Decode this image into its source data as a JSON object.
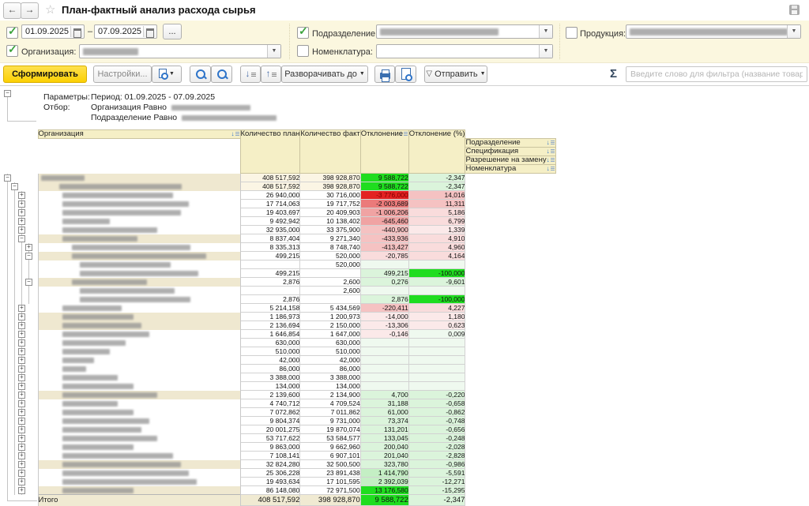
{
  "titlebar": {
    "title": "План-фактный анализ расхода сырья",
    "back_icon": "←",
    "forward_icon": "→",
    "star_icon": "☆",
    "save_icon": "floppy-disk"
  },
  "filters": {
    "period": {
      "checked": true,
      "from": "01.09.2025",
      "dash": "–",
      "to": "07.09.2025",
      "more_label": "...",
      "calendar_icon": "calendar"
    },
    "organization": {
      "checked": true,
      "label": "Организация:",
      "value_redacted": true,
      "value_w": 70
    },
    "department": {
      "checked": true,
      "label": "Подразделение:",
      "value_redacted": true,
      "value_w": 150
    },
    "nomenclature": {
      "checked": false,
      "label": "Номенклатура:",
      "value_redacted": false,
      "value_w": 0
    },
    "production": {
      "checked": false,
      "label": "Продукция:",
      "value_redacted": true,
      "value_w": 200
    }
  },
  "toolbar": {
    "generate_label": "Сформировать",
    "settings_label": "Настройки...",
    "variants_icon": "report-variants",
    "search_icon": "magnifier",
    "search_next_icon": "magnifier-repeat",
    "collapse_icon": "arrow-down-bars",
    "expand_icon": "arrow-up-bar",
    "expand_to_label": "Разворачивать до",
    "print_icon": "printer",
    "preview_icon": "print-preview",
    "send_label": "Отправить",
    "send_icon": "funnel",
    "sigma": "Σ",
    "filter_placeholder": "Введите слово для фильтра (название товара, покупателя"
  },
  "params": {
    "label": "Параметры:",
    "period_line": "Период: 01.09.2025 - 07.09.2025",
    "filter_label": "Отбор:",
    "org_line": "Организация Равно",
    "org_value_redacted_w": 100,
    "dept_line": "Подразделение Равно",
    "dept_value_redacted_w": 120
  },
  "table": {
    "names_redacted": true,
    "row_headers": [
      "Организация",
      "Подразделение",
      "Спецификация",
      "Разрешение на замену",
      "Номенклатура"
    ],
    "col_headers": [
      "Количество план",
      "Количество факт",
      "Отклонение",
      "Отклонение (%)"
    ],
    "sort_icon": "sort-descending",
    "rows": [
      {
        "lv": 1,
        "exp": "minus",
        "lines": [
          1
        ],
        "tan": 1,
        "cream": 1,
        "name_w": 55,
        "plan": "408 517,592",
        "fact": "398 928,870",
        "dev": "9 588,722",
        "dc": "g3",
        "pct": "-2,347",
        "pc": "g1"
      },
      {
        "lv": 2,
        "exp": "minus",
        "lines": [
          1,
          2
        ],
        "tan": 1,
        "cream": 1,
        "name_w": 155,
        "plan": "408 517,592",
        "fact": "398 928,870",
        "dev": "9 588,722",
        "dc": "g3",
        "pct": "-2,347",
        "pc": "g1"
      },
      {
        "lv": 3,
        "exp": "plus",
        "lines": [
          1,
          2,
          3
        ],
        "tan": 0,
        "name_w": 140,
        "plan": "26 940,000",
        "fact": "30 716,000",
        "dev": "-3 776,000",
        "dc": "r4",
        "pct": "14,016",
        "pc": "r1"
      },
      {
        "lv": 3,
        "exp": "plus",
        "lines": [
          1,
          2,
          3
        ],
        "tan": 0,
        "name_w": 160,
        "plan": "17 714,063",
        "fact": "19 717,752",
        "dev": "-2 003,689",
        "dc": "r3",
        "pct": "11,311",
        "pc": "r1"
      },
      {
        "lv": 3,
        "exp": "plus",
        "lines": [
          1,
          2,
          3
        ],
        "tan": 0,
        "name_w": 150,
        "plan": "19 403,697",
        "fact": "20 409,903",
        "dev": "-1 006,206",
        "dc": "r2",
        "pct": "5,186",
        "pc": "r0"
      },
      {
        "lv": 3,
        "exp": "plus",
        "lines": [
          1,
          2,
          3
        ],
        "tan": 0,
        "name_w": 60,
        "plan": "9 492,942",
        "fact": "10 138,402",
        "dev": "-645,460",
        "dc": "r2",
        "pct": "6,799",
        "pc": "r0"
      },
      {
        "lv": 3,
        "exp": "plus",
        "lines": [
          1,
          2,
          3
        ],
        "tan": 0,
        "name_w": 120,
        "plan": "32 935,000",
        "fact": "33 375,900",
        "dev": "-440,900",
        "dc": "r1",
        "pct": "1,339",
        "pc": "rp"
      },
      {
        "lv": 3,
        "exp": "minus",
        "lines": [
          1,
          2,
          3
        ],
        "tan": 1,
        "name_w": 95,
        "plan": "8 837,404",
        "fact": "9 271,340",
        "dev": "-433,936",
        "dc": "r1",
        "pct": "4,910",
        "pc": "r0"
      },
      {
        "lv": 4,
        "exp": "plus",
        "lines": [
          1,
          2,
          3,
          4
        ],
        "tan": 0,
        "name_w": 150,
        "plan": "8 335,313",
        "fact": "8 748,740",
        "dev": "-413,427",
        "dc": "r1",
        "pct": "4,960",
        "pc": "r0"
      },
      {
        "lv": 4,
        "exp": "minus",
        "lines": [
          1,
          2,
          3,
          4
        ],
        "tan": 1,
        "name_w": 170,
        "plan": "499,215",
        "fact": "520,000",
        "dev": "-20,785",
        "dc": "r0",
        "pct": "4,164",
        "pc": "r0"
      },
      {
        "lv": 5,
        "exp": null,
        "lines": [
          1,
          2,
          3,
          4
        ],
        "tan": 0,
        "name_w": 115,
        "plan": "",
        "fact": "520,000",
        "dev": "",
        "dc": "g0",
        "pct": "",
        "pc": "g0"
      },
      {
        "lv": 5,
        "exp": null,
        "lines": [
          1,
          2,
          3,
          4
        ],
        "tan": 0,
        "name_w": 150,
        "plan": "499,215",
        "fact": "",
        "dev": "499,215",
        "dc": "g1",
        "pct": "-100,000",
        "pc": "g3"
      },
      {
        "lv": 4,
        "exp": "minus",
        "lines": [
          1,
          2,
          3,
          4
        ],
        "tan": 1,
        "name_w": 95,
        "plan": "2,876",
        "fact": "2,600",
        "dev": "0,276",
        "dc": "g1",
        "pct": "-9,601",
        "pc": "g1"
      },
      {
        "lv": 5,
        "exp": null,
        "lines": [
          1,
          2,
          3,
          4
        ],
        "tan": 0,
        "name_w": 120,
        "plan": "",
        "fact": "2,600",
        "dev": "",
        "dc": "g0",
        "pct": "",
        "pc": "g0"
      },
      {
        "lv": 5,
        "exp": null,
        "lines": [
          1,
          2,
          3,
          4
        ],
        "tan": 0,
        "name_w": 140,
        "plan": "2,876",
        "fact": "",
        "dev": "2,876",
        "dc": "g1",
        "pct": "-100,000",
        "pc": "g3"
      },
      {
        "lv": 3,
        "exp": "plus",
        "lines": [
          1,
          2,
          3
        ],
        "tan": 0,
        "name_w": 75,
        "plan": "5 214,158",
        "fact": "5 434,569",
        "dev": "-220,411",
        "dc": "r1",
        "pct": "4,227",
        "pc": "r0"
      },
      {
        "lv": 3,
        "exp": "plus",
        "lines": [
          1,
          2,
          3
        ],
        "tan": 1,
        "name_w": 90,
        "plan": "1 186,973",
        "fact": "1 200,973",
        "dev": "-14,000",
        "dc": "rp",
        "pct": "1,180",
        "pc": "rp"
      },
      {
        "lv": 3,
        "exp": "plus",
        "lines": [
          1,
          2,
          3
        ],
        "tan": 1,
        "name_w": 100,
        "plan": "2 136,694",
        "fact": "2 150,000",
        "dev": "-13,306",
        "dc": "rp",
        "pct": "0,623",
        "pc": "rp"
      },
      {
        "lv": 3,
        "exp": "plus",
        "lines": [
          1,
          2,
          3
        ],
        "tan": 0,
        "name_w": 110,
        "plan": "1 646,854",
        "fact": "1 647,000",
        "dev": "-0,146",
        "dc": "rp",
        "pct": "0,009",
        "pc": "g0"
      },
      {
        "lv": 3,
        "exp": "plus",
        "lines": [
          1,
          2,
          3
        ],
        "tan": 0,
        "name_w": 80,
        "plan": "630,000",
        "fact": "630,000",
        "dev": "",
        "dc": "g0",
        "pct": "",
        "pc": "g0"
      },
      {
        "lv": 3,
        "exp": "plus",
        "lines": [
          1,
          2,
          3
        ],
        "tan": 0,
        "name_w": 60,
        "plan": "510,000",
        "fact": "510,000",
        "dev": "",
        "dc": "g0",
        "pct": "",
        "pc": "g0"
      },
      {
        "lv": 3,
        "exp": "plus",
        "lines": [
          1,
          2,
          3
        ],
        "tan": 0,
        "name_w": 40,
        "plan": "42,000",
        "fact": "42,000",
        "dev": "",
        "dc": "g0",
        "pct": "",
        "pc": "g0"
      },
      {
        "lv": 3,
        "exp": "plus",
        "lines": [
          1,
          2,
          3
        ],
        "tan": 0,
        "name_w": 30,
        "plan": "86,000",
        "fact": "86,000",
        "dev": "",
        "dc": "g0",
        "pct": "",
        "pc": "g0"
      },
      {
        "lv": 3,
        "exp": "plus",
        "lines": [
          1,
          2,
          3
        ],
        "tan": 0,
        "name_w": 70,
        "plan": "3 388,000",
        "fact": "3 388,000",
        "dev": "",
        "dc": "g0",
        "pct": "",
        "pc": "g0"
      },
      {
        "lv": 3,
        "exp": "plus",
        "lines": [
          1,
          2,
          3
        ],
        "tan": 0,
        "name_w": 90,
        "plan": "134,000",
        "fact": "134,000",
        "dev": "",
        "dc": "g0",
        "pct": "",
        "pc": "g0"
      },
      {
        "lv": 3,
        "exp": "plus",
        "lines": [
          1,
          2,
          3
        ],
        "tan": 1,
        "name_w": 120,
        "plan": "2 139,600",
        "fact": "2 134,900",
        "dev": "4,700",
        "dc": "g1",
        "pct": "-0,220",
        "pc": "g1"
      },
      {
        "lv": 3,
        "exp": "plus",
        "lines": [
          1,
          2,
          3
        ],
        "tan": 0,
        "name_w": 70,
        "plan": "4 740,712",
        "fact": "4 709,524",
        "dev": "31,188",
        "dc": "g1",
        "pct": "-0,658",
        "pc": "g1"
      },
      {
        "lv": 3,
        "exp": "plus",
        "lines": [
          1,
          2,
          3
        ],
        "tan": 0,
        "name_w": 90,
        "plan": "7 072,862",
        "fact": "7 011,862",
        "dev": "61,000",
        "dc": "g1",
        "pct": "-0,862",
        "pc": "g1"
      },
      {
        "lv": 3,
        "exp": "plus",
        "lines": [
          1,
          2,
          3
        ],
        "tan": 0,
        "name_w": 110,
        "plan": "9 804,374",
        "fact": "9 731,000",
        "dev": "73,374",
        "dc": "g1",
        "pct": "-0,748",
        "pc": "g1"
      },
      {
        "lv": 3,
        "exp": "plus",
        "lines": [
          1,
          2,
          3
        ],
        "tan": 0,
        "name_w": 100,
        "plan": "20 001,275",
        "fact": "19 870,074",
        "dev": "131,201",
        "dc": "g1",
        "pct": "-0,656",
        "pc": "g1"
      },
      {
        "lv": 3,
        "exp": "plus",
        "lines": [
          1,
          2,
          3
        ],
        "tan": 0,
        "name_w": 120,
        "plan": "53 717,622",
        "fact": "53 584,577",
        "dev": "133,045",
        "dc": "g1",
        "pct": "-0,248",
        "pc": "g1"
      },
      {
        "lv": 3,
        "exp": "plus",
        "lines": [
          1,
          2,
          3
        ],
        "tan": 0,
        "name_w": 90,
        "plan": "9 863,000",
        "fact": "9 662,960",
        "dev": "200,040",
        "dc": "g1",
        "pct": "-2,028",
        "pc": "g1"
      },
      {
        "lv": 3,
        "exp": "plus",
        "lines": [
          1,
          2,
          3
        ],
        "tan": 0,
        "name_w": 140,
        "plan": "7 108,141",
        "fact": "6 907,101",
        "dev": "201,040",
        "dc": "g1",
        "pct": "-2,828",
        "pc": "g1"
      },
      {
        "lv": 3,
        "exp": "plus",
        "lines": [
          1,
          2,
          3
        ],
        "tan": 1,
        "name_w": 150,
        "plan": "32 824,280",
        "fact": "32 500,500",
        "dev": "323,780",
        "dc": "g1",
        "pct": "-0,986",
        "pc": "g1"
      },
      {
        "lv": 3,
        "exp": "plus",
        "lines": [
          1,
          2,
          3
        ],
        "tan": 0,
        "name_w": 160,
        "plan": "25 306,228",
        "fact": "23 891,438",
        "dev": "1 414,790",
        "dc": "g2",
        "pct": "-5,591",
        "pc": "g1"
      },
      {
        "lv": 3,
        "exp": "plus",
        "lines": [
          1,
          2,
          3
        ],
        "tan": 0,
        "name_w": 170,
        "plan": "19 493,634",
        "fact": "17 101,595",
        "dev": "2 392,039",
        "dc": "g2",
        "pct": "-12,271",
        "pc": "g1"
      },
      {
        "lv": 3,
        "exp": "plus",
        "lines": [
          1,
          2,
          3
        ],
        "tan": 1,
        "name_w": 90,
        "plan": "86 148,080",
        "fact": "72 971,500",
        "dev": "13 176,580",
        "dc": "g3",
        "pct": "-15,295",
        "pc": "g1"
      }
    ],
    "total": {
      "label": "Итого",
      "plan": "408 517,592",
      "fact": "398 928,870",
      "dev": "9 588,722",
      "dc": "g3",
      "pct": "-2,347",
      "pc": "g1"
    }
  },
  "colors": {
    "accent_button": "#FBD004",
    "bright_green": "#1FDD1F",
    "mid_green": "#C4EFC4",
    "light_green": "#DBF4DB",
    "pale_green": "#EFF9EF",
    "bright_red": "#E32222",
    "red_mid": "#EB7A7A",
    "red_soft": "#F0A3A3",
    "pink": "#F5C2C2",
    "pink_light": "#F9DCDC",
    "pink_pale": "#FBE9E9",
    "group_tan": "#EFE8D0",
    "cream": "#FBF5E4",
    "header_yellow": "#F5EFC6",
    "filter_bg": "#FBF7DF",
    "icon_blue": "#2E74C9",
    "check_green": "#3BA33B"
  }
}
